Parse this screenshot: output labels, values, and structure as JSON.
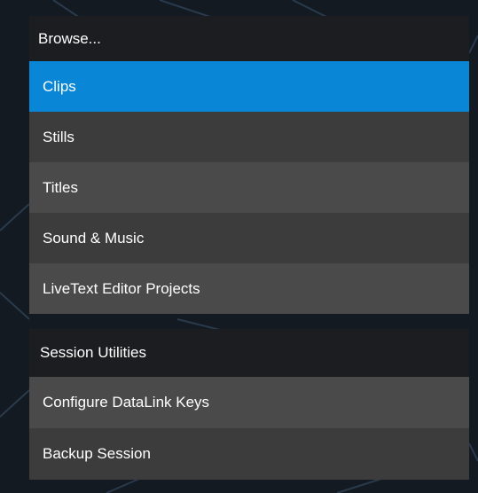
{
  "colors": {
    "selected": "#0a86d6",
    "header_bg": "#1c1d20",
    "row_dark": "#3c3c3c",
    "row_light": "#4a4a4a",
    "backdrop": "#141a22"
  },
  "browse": {
    "header": "Browse...",
    "items": [
      {
        "label": "Clips",
        "selected": true
      },
      {
        "label": "Stills",
        "selected": false
      },
      {
        "label": "Titles",
        "selected": false
      },
      {
        "label": "Sound & Music",
        "selected": false
      },
      {
        "label": "LiveText Editor Projects",
        "selected": false
      }
    ]
  },
  "session": {
    "header": "Session Utilities",
    "items": [
      {
        "label": "Configure DataLink Keys"
      },
      {
        "label": "Backup Session"
      }
    ]
  }
}
